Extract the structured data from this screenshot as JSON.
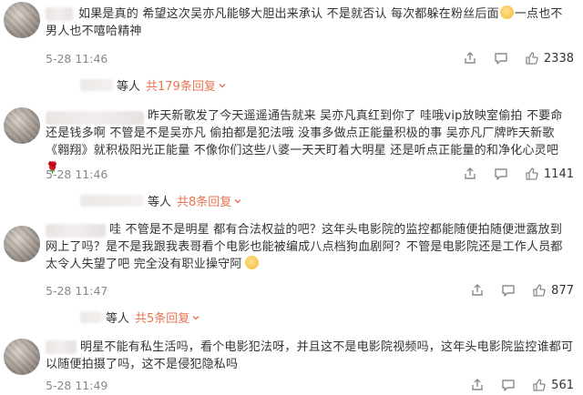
{
  "comments": [
    {
      "text_lead": "如果是真的 希望这次吴亦凡能够大胆出来承认 不是就否认 每次都躲在粉丝后面",
      "text_tail": "一点也不男人也不嘻哈精神",
      "time": "5-28 11:46",
      "likes": "2338",
      "reply_suffix": "等人",
      "reply_link": "共179条回复"
    },
    {
      "text_lead": "昨天新歌发了今天遥遥通告就来 吴亦凡真红到你了 哇哦vip放映室偷拍 不要命还是钱多啊 不管是不是吴亦凡 偷拍都是犯法哦 没事多做点正能量积极的事 吴亦凡厂牌昨天新歌《翱翔》就积极阳光正能量 不像你们这些八婆一天天盯着大明星 还是听点正能量的和净化心灵吧",
      "time": "5-28 11:46",
      "likes": "1141",
      "reply_suffix": "等人",
      "reply_link": "共8条回复"
    },
    {
      "text_lead": "哇 不管是不是明星 都有合法权益的吧？这年头电影院的监控都能随便拍随便泄露放到网上了吗？是不是我跟我表哥看个电影也能被编成八点档狗血剧阿？不管是电影院还是工作人员都太令人失望了吧 完全没有职业操守阿",
      "time": "5-28 11:47",
      "likes": "877",
      "reply_suffix": "等人",
      "reply_link": "共5条回复"
    },
    {
      "text_lead": "明星不能有私生活吗，看个电影犯法呀，并且这不是电影院视频吗，这年头电影院监控谁都可以随便拍摄了吗，这不是侵犯隐私吗",
      "time": "5-28 11:49",
      "likes": "561"
    }
  ],
  "icons": {
    "share": "share-icon",
    "comment": "comment-icon",
    "like": "thumbs-up-icon",
    "chevron": "chevron-down-icon"
  },
  "colors": {
    "reply_link": "#eb7350",
    "meta": "#888888"
  }
}
